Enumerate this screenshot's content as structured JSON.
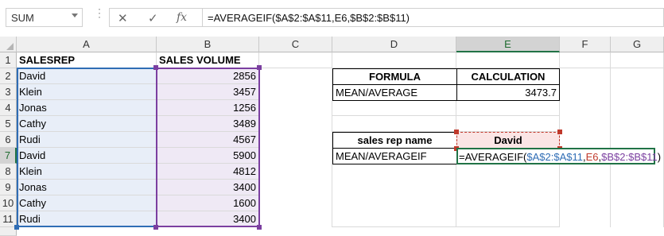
{
  "formula_bar": {
    "name_box": "SUM",
    "cancel_icon": "close-icon",
    "enter_icon": "check-icon",
    "fx_label": "fx",
    "formula": "=AVERAGEIF($A$2:$A$11,E6,$B$2:$B$11)"
  },
  "columns": [
    "A",
    "B",
    "C",
    "D",
    "E",
    "F",
    "G"
  ],
  "rows": [
    "1",
    "2",
    "3",
    "4",
    "5",
    "6",
    "7",
    "8",
    "9",
    "10",
    "11"
  ],
  "sheet": {
    "A1": "SALESREP",
    "B1": "SALES VOLUME",
    "reps": [
      "David",
      "Klein",
      "Jonas",
      "Cathy",
      "Rudi",
      "David",
      "Klein",
      "Jonas",
      "Cathy",
      "Rudi"
    ],
    "volumes": [
      "2856",
      "3457",
      "1256",
      "3489",
      "4567",
      "5900",
      "4812",
      "3400",
      "1600",
      "3400"
    ],
    "D2": "FORMULA",
    "E2": "CALCULATION",
    "D3": "MEAN/AVERAGE",
    "E3": "3473.7",
    "D6": "sales rep name",
    "E6": "David",
    "D7": "MEAN/AVERAGEIF",
    "E7": {
      "p1": "=AVERAGEIF(",
      "p2": "$A$2:$A$11",
      "p3": ",",
      "p4": "E6",
      "p5": ",",
      "p6": "$B$2:$B$11",
      "p7": ")"
    }
  },
  "colors": {
    "ref_range_a": "#2f6db5",
    "ref_cell_e6": "#c0392b",
    "ref_range_b": "#7b3fa0",
    "excel_green": "#217346"
  }
}
